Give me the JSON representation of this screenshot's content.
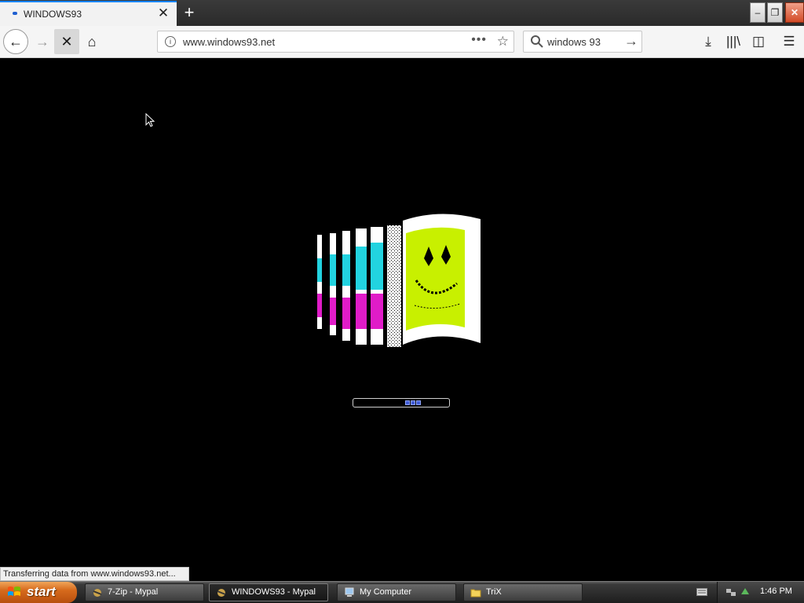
{
  "browser": {
    "tab": {
      "title": "WINDOWS93"
    },
    "new_tab_label": "+",
    "window_controls": {
      "minimize": "–",
      "maximize": "❐",
      "close": "✕"
    },
    "nav": {
      "back": "←",
      "forward": "→",
      "stop": "✕",
      "home": "⌂"
    },
    "url": "www.windows93.net",
    "url_menu": "•••",
    "bookmark": "☆",
    "search": {
      "value": "windows 93",
      "go": "→"
    },
    "tools": {
      "downloads": "⤓",
      "library": "|||\\",
      "sidebar": "◫",
      "menu": "☰"
    }
  },
  "page": {
    "loader": {
      "progress_blocks": 3
    },
    "status_text": "Transferring data from www.windows93.net..."
  },
  "taskbar": {
    "start_label": "start",
    "tasks": [
      {
        "label": "7-Zip - Mypal",
        "active": false
      },
      {
        "label": "WINDOWS93 - Mypal",
        "active": true
      },
      {
        "label": "My Computer",
        "active": false
      },
      {
        "label": "TriX",
        "active": false
      }
    ],
    "clock": "1:46 PM"
  },
  "colors": {
    "page_bg": "#000000",
    "flag_cyan": "#22d3e0",
    "flag_magenta": "#e01cc8",
    "flag_lime": "#c8f000",
    "progress_blue": "#3f5bd6",
    "start_orange": "#d66a1c"
  }
}
